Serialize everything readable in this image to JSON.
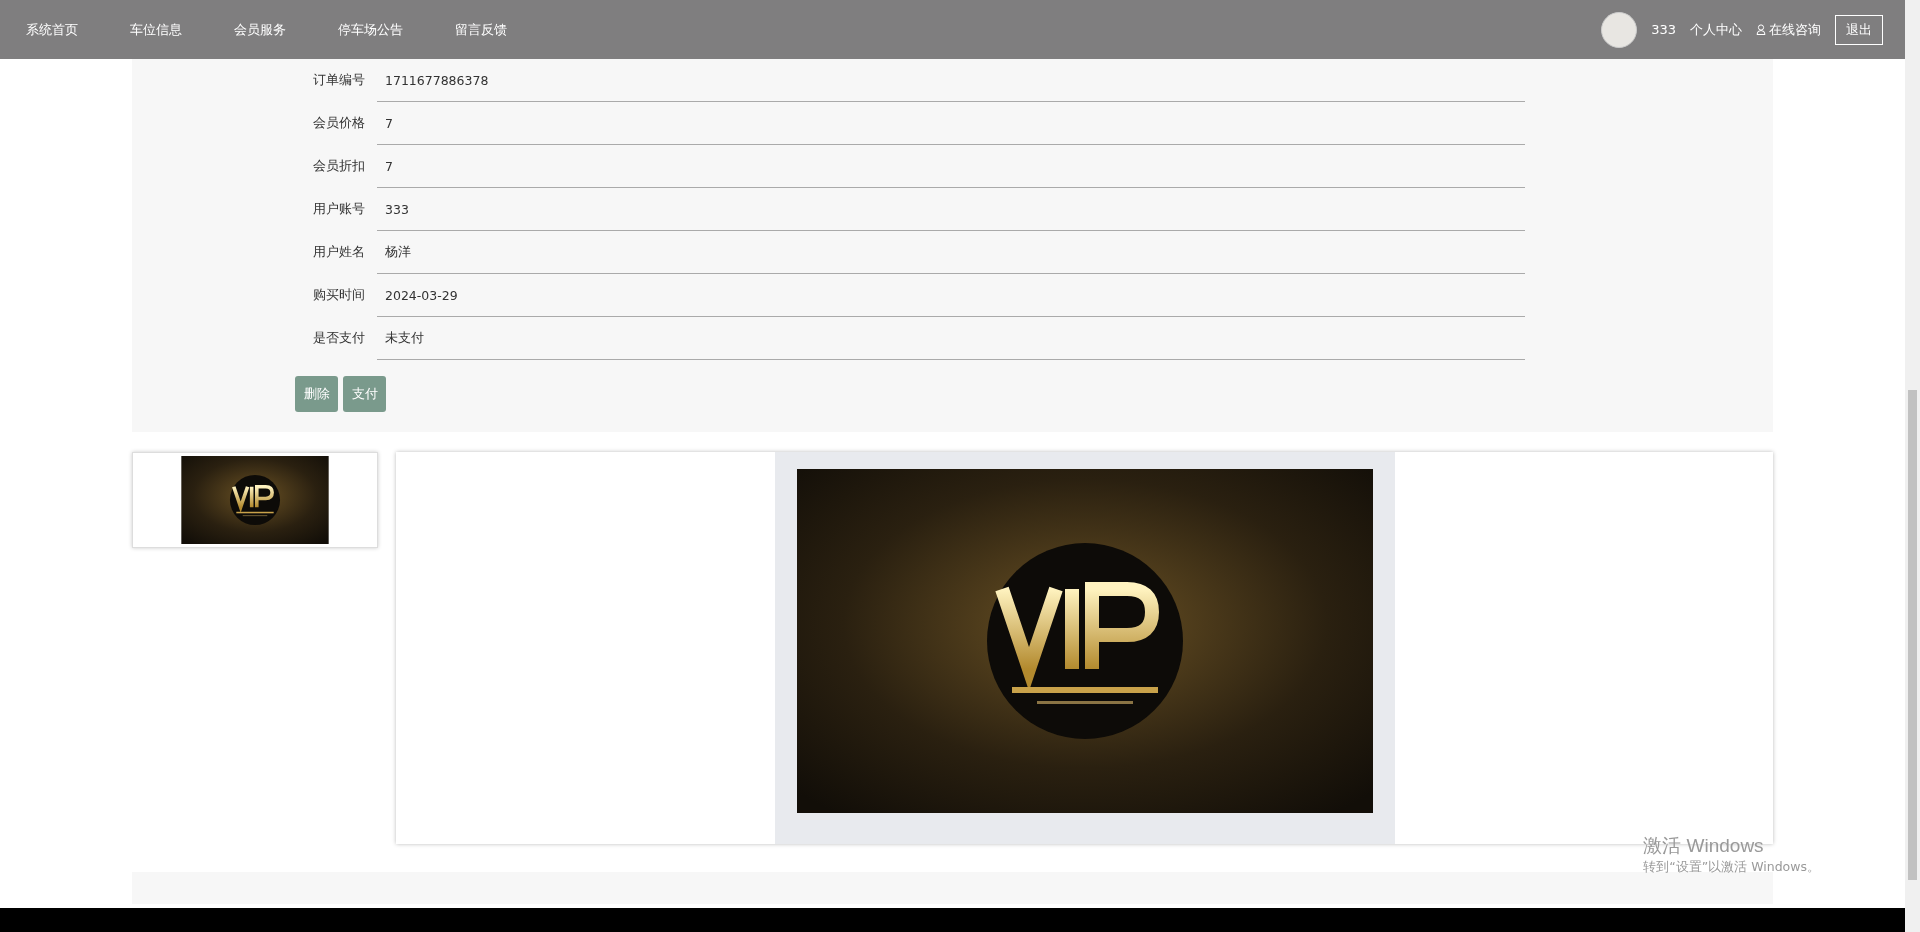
{
  "nav": {
    "items": [
      {
        "label": "系统首页"
      },
      {
        "label": "车位信息"
      },
      {
        "label": "会员服务"
      },
      {
        "label": "停车场公告"
      },
      {
        "label": "留言反馈"
      }
    ],
    "user": {
      "name": "333",
      "center": "个人中心",
      "consult": "在线咨询",
      "logout": "退出"
    }
  },
  "detail": {
    "fields": [
      {
        "label": "订单编号",
        "value": "1711677886378"
      },
      {
        "label": "会员价格",
        "value": "7"
      },
      {
        "label": "会员折扣",
        "value": "7"
      },
      {
        "label": "用户账号",
        "value": "333"
      },
      {
        "label": "用户姓名",
        "value": "杨洋"
      },
      {
        "label": "购买时间",
        "value": "2024-03-29"
      },
      {
        "label": "是否支付",
        "value": "未支付"
      }
    ],
    "buttons": [
      "删除",
      "支付"
    ]
  },
  "gallery": {
    "thumbnails": [
      {
        "selected": true
      }
    ]
  },
  "os_notice": {
    "title": "激活 Windows",
    "subtitle": "转到“设置”以激活 Windows。"
  }
}
